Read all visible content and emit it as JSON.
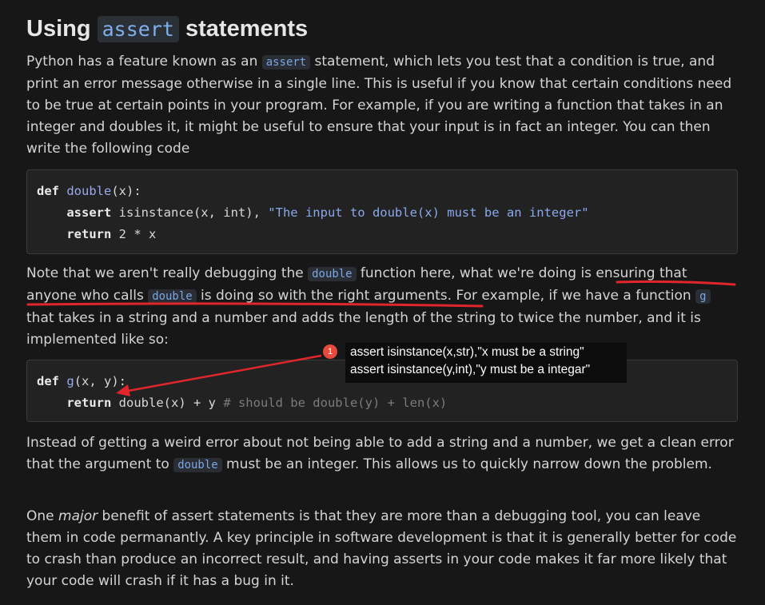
{
  "heading": {
    "prefix": "Using",
    "code": "assert",
    "suffix": "statements"
  },
  "para1": {
    "t1": "Python has a feature known as an",
    "code": "assert",
    "t2": "statement, which lets you test that a condition is true, and print an error message otherwise in a single line. This is useful if you know that certain conditions need to be true at certain points in your program. For example, if you are writing a function that takes in an integer and doubles it, it might be useful to ensure that your input is in fact an integer. You can then write the following code"
  },
  "code1": {
    "l1_kw": "def",
    "l1_fn": "double",
    "l1_rest": "(x):",
    "l2_kw": "assert",
    "l2_mid": " isinstance(x, int), ",
    "l2_str": "\"The input to double(x) must be an integer\"",
    "l3_kw": "return",
    "l3_rest": " 2 * x"
  },
  "para2": {
    "t1": "Note that we aren't really debugging the",
    "code1": "double",
    "t2": "function here, what we're doing",
    "t3": "is ensuring that anyone who calls",
    "code2": "double",
    "t4": "is doing so with the right arguments.",
    "t5": "For example, if we have a function",
    "code3": "g",
    "t6": "that takes in a string and a number and adds the length of the string to twice the number, and it is implemented like so:"
  },
  "code2": {
    "l1_kw": "def",
    "l1_fn": "g",
    "l1_rest": "(x, y):",
    "l2_kw": "return",
    "l2_rest": " double(x) + y ",
    "l2_cm": "# should be double(y) + len(x)"
  },
  "annotation": {
    "number": "1",
    "line1": "assert isinstance(x,str),\"x must be a string\"",
    "line2": "assert isinstance(y,int),\"y must be a integar\"",
    "color": "#e0262b"
  },
  "para3": {
    "t1": "Instead of getting a weird error about not being able to add a string and a number, we get a clean error that the argument to",
    "code": "double",
    "t2": "must be an integer. This allows us to quickly narrow down the problem."
  },
  "para4": {
    "t1": "One",
    "em": "major",
    "t2": "benefit of assert statements is that they are more than a debugging tool, you can leave them in code permanantly. A key principle in software development is that it is generally better for code to crash than produce an incorrect result, and having asserts in your code makes it far more likely that your code will crash if it has a bug in it."
  }
}
